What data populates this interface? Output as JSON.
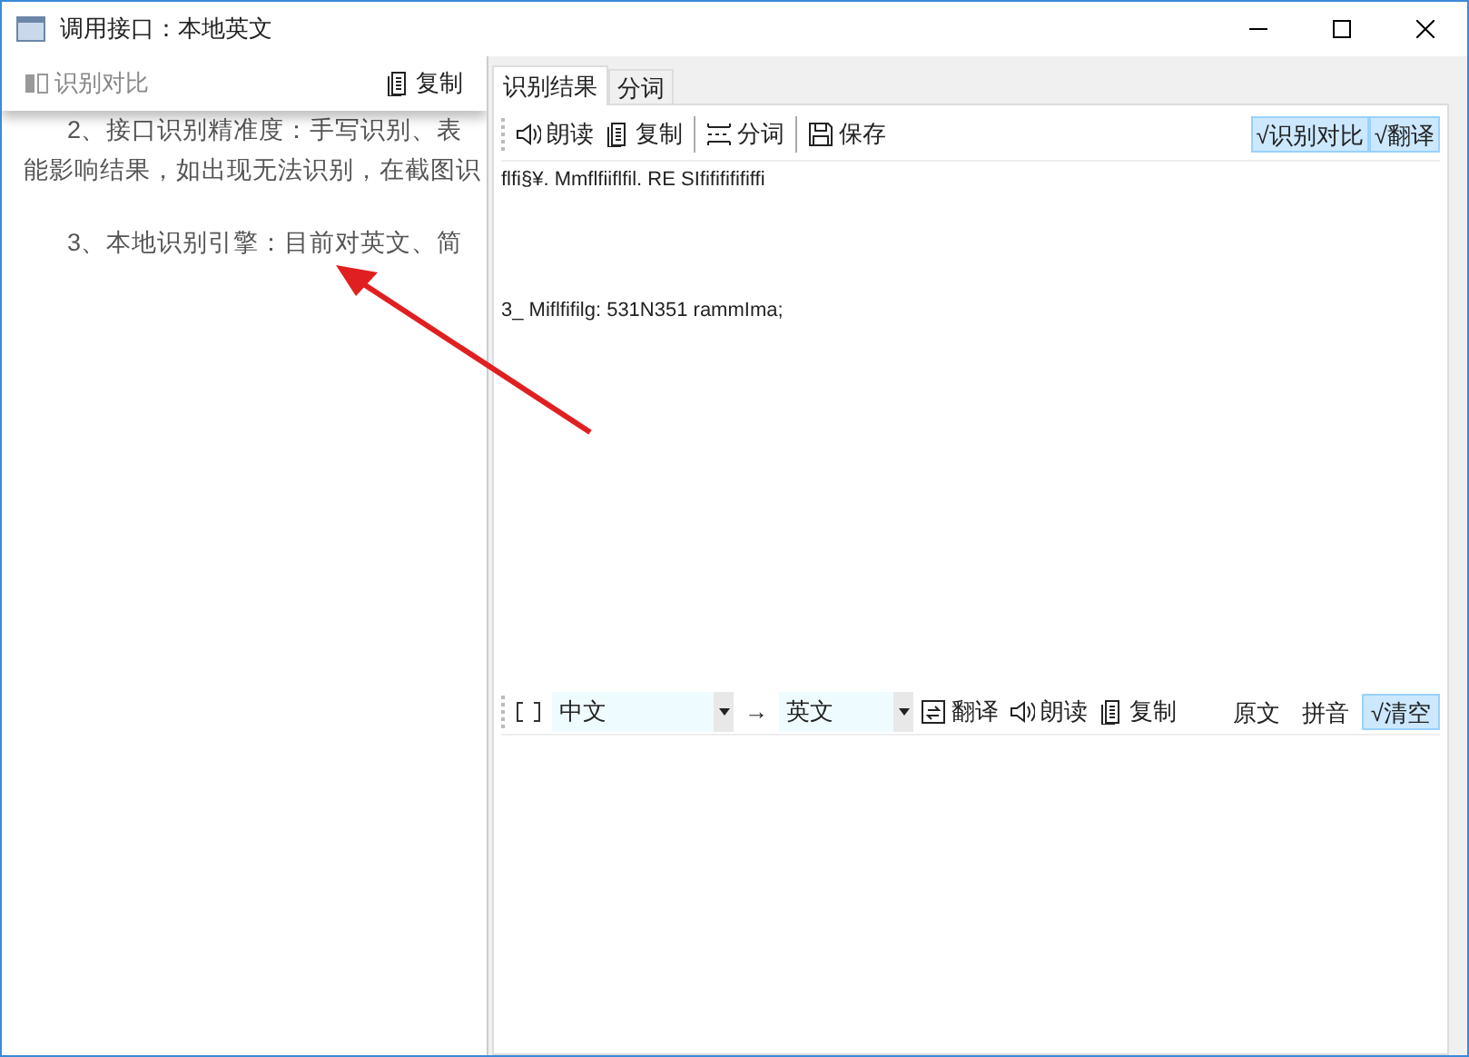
{
  "window": {
    "title": "调用接口：本地英文"
  },
  "capture": {
    "toolbar": [
      {
        "kind": "compare",
        "label": "识别对比"
      },
      {
        "kind": "copy",
        "label": "复制"
      }
    ],
    "lines": [
      {
        "kind": "indent",
        "text": "2、接口识别精准度：手写识别、表"
      },
      {
        "kind": "plain",
        "text": "能影响结果，如出现无法识别，在截图识"
      },
      {
        "kind": "paragraph",
        "text": "3、本地识别引擎：目前对英文、简"
      }
    ]
  },
  "tabs": [
    {
      "label": "识别结果",
      "selected": true
    },
    {
      "label": "分词",
      "selected": false
    }
  ],
  "toolbar": [
    {
      "kind": "speaker",
      "label": "朗读"
    },
    {
      "kind": "copy",
      "label": "复制"
    },
    {
      "kind": "sep"
    },
    {
      "kind": "split",
      "label": "分词"
    },
    {
      "kind": "sep"
    },
    {
      "kind": "save",
      "label": "保存"
    }
  ],
  "toggles": [
    {
      "label": "√识别对比",
      "on": true
    },
    {
      "label": "√翻译",
      "on": true
    }
  ],
  "result_lines": [
    "flfi§¥. Mmflfiiflfil. RE SIfifififififfi",
    "3_ Miflfifilg: 531N351 rammIma;"
  ],
  "translate": {
    "source": "中文",
    "arrow": "→",
    "target": "英文",
    "actions": [
      {
        "kind": "translate",
        "label": "翻译"
      },
      {
        "kind": "speaker",
        "label": "朗读"
      },
      {
        "kind": "copy",
        "label": "复制"
      }
    ],
    "options": [
      {
        "label": "原文",
        "on": false
      },
      {
        "label": "拼音",
        "on": false
      },
      {
        "label": "√清空",
        "on": true
      }
    ]
  }
}
